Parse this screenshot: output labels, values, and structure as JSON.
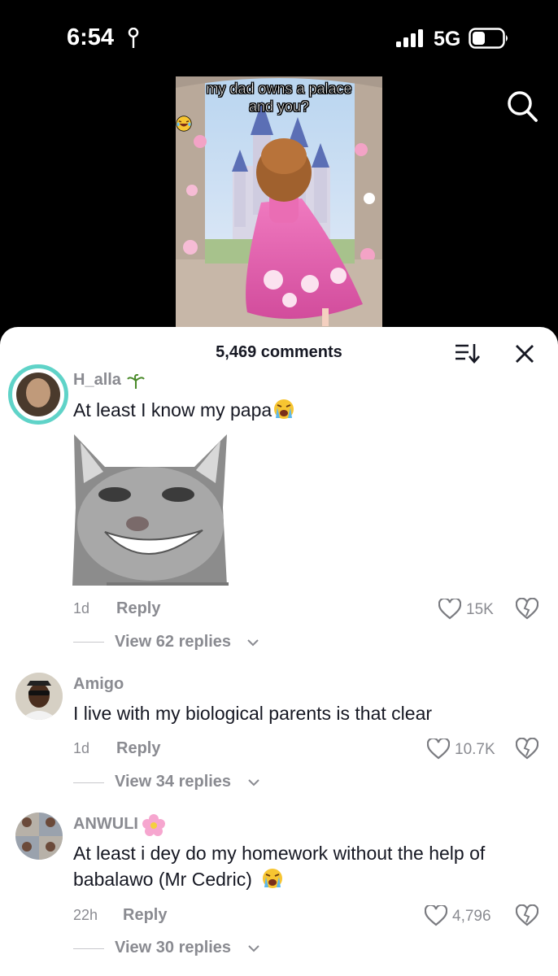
{
  "status_bar": {
    "time": "6:54",
    "network": "5G"
  },
  "video": {
    "caption_line1": "my dad owns a palace",
    "caption_line2": "and you?"
  },
  "sheet": {
    "title": "5,469 comments"
  },
  "comments": [
    {
      "username": "H_alla",
      "text": "At least I know my papa",
      "age": "1d",
      "reply_label": "Reply",
      "likes": "15K",
      "view_replies": "View 62 replies"
    },
    {
      "username": "Amigo",
      "text": "I live with my biological parents is that clear",
      "age": "1d",
      "reply_label": "Reply",
      "likes": "10.7K",
      "view_replies": "View 34 replies"
    },
    {
      "username": "ANWULI",
      "text_line1": "At least i dey do my homework without the help of",
      "text_line2": "babalawo (Mr Cedric)",
      "age": "22h",
      "reply_label": "Reply",
      "likes": "4,796",
      "view_replies": "View 30 replies"
    }
  ],
  "colors": {
    "accent_ring": "#5fd3c8",
    "text_primary": "#161823",
    "text_secondary": "#8a8b91"
  }
}
